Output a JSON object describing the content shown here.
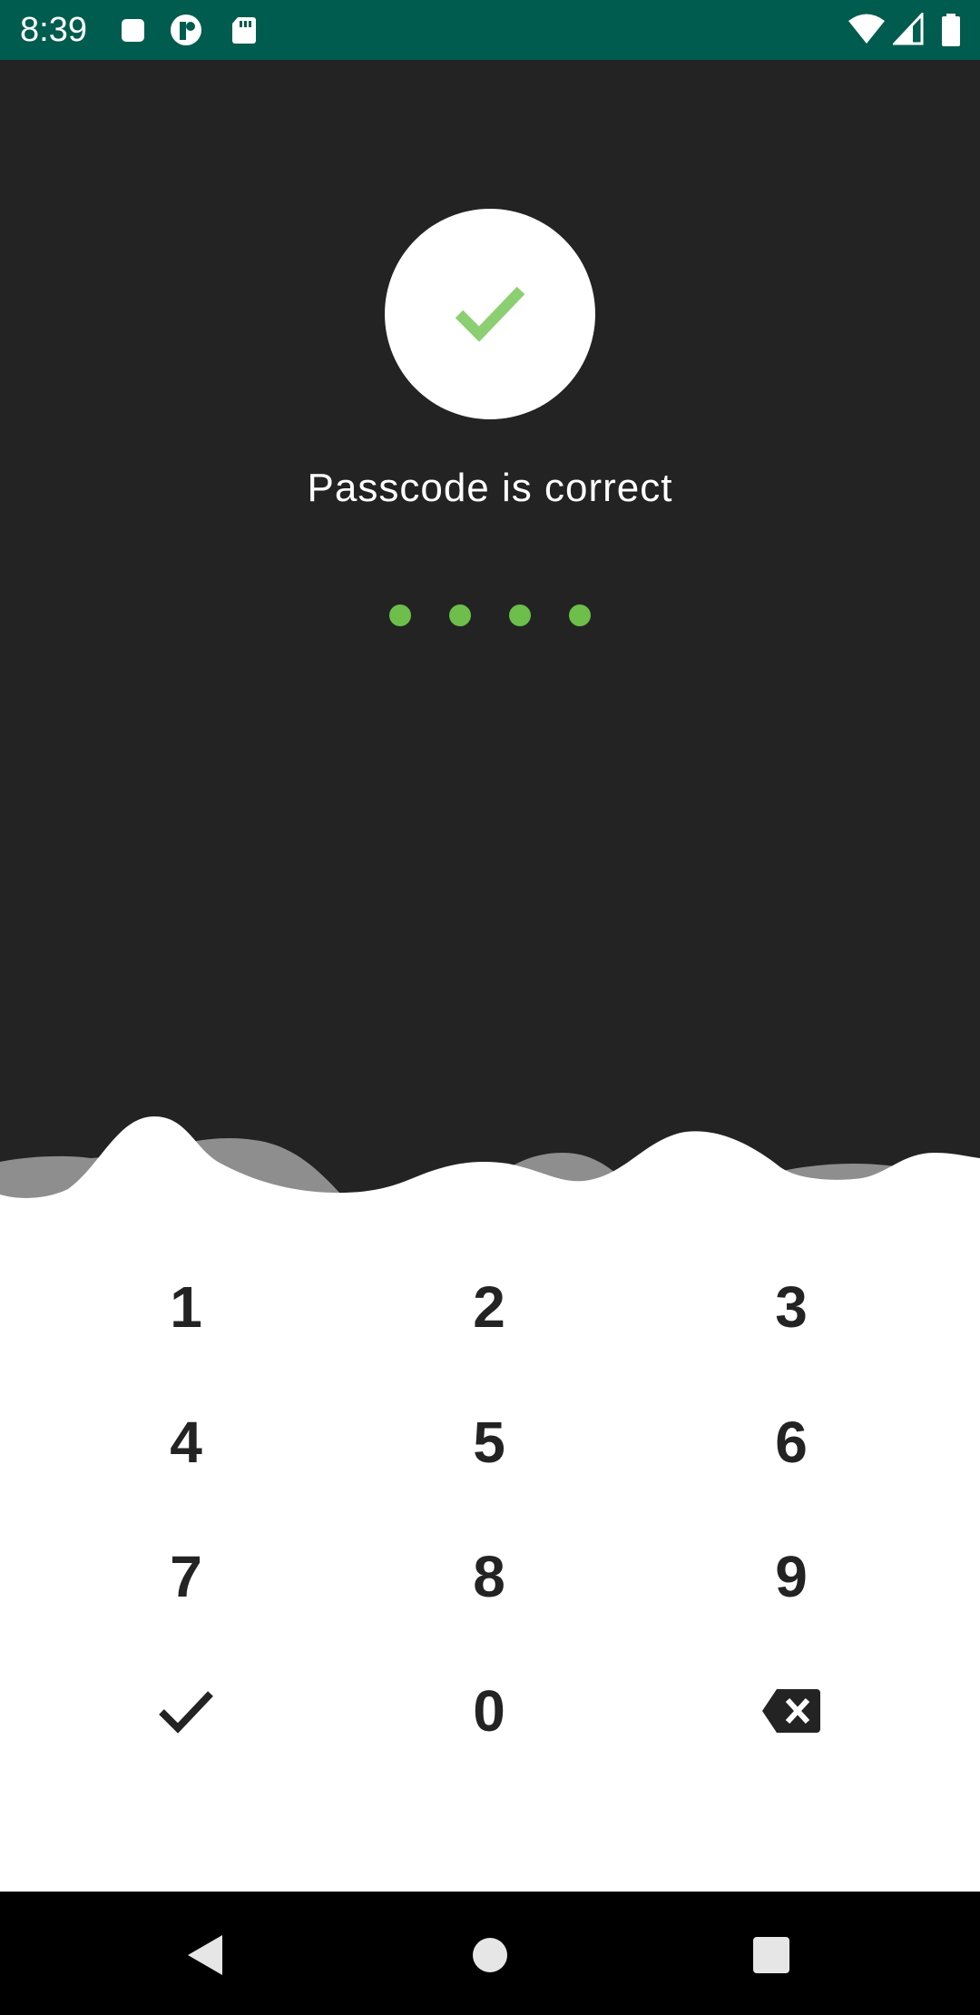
{
  "status_bar": {
    "time": "8:39",
    "background": "#005C4E",
    "left_icons": [
      "stop-square-icon",
      "t-app-icon",
      "sd-card-icon"
    ],
    "right_icons": [
      "wifi-icon",
      "cell-signal-icon",
      "battery-icon"
    ]
  },
  "lock_screen": {
    "status_icon": "check-icon",
    "message": "Passcode is correct",
    "entered_digits": 4,
    "accent_color": "#6DBE4B",
    "background": "#232323"
  },
  "keypad": {
    "keys": [
      "1",
      "2",
      "3",
      "4",
      "5",
      "6",
      "7",
      "8",
      "9",
      "0"
    ],
    "confirm_icon": "check-icon",
    "delete_icon": "backspace-icon"
  },
  "nav_bar": {
    "buttons": [
      "back-icon",
      "home-icon",
      "recents-icon"
    ]
  }
}
